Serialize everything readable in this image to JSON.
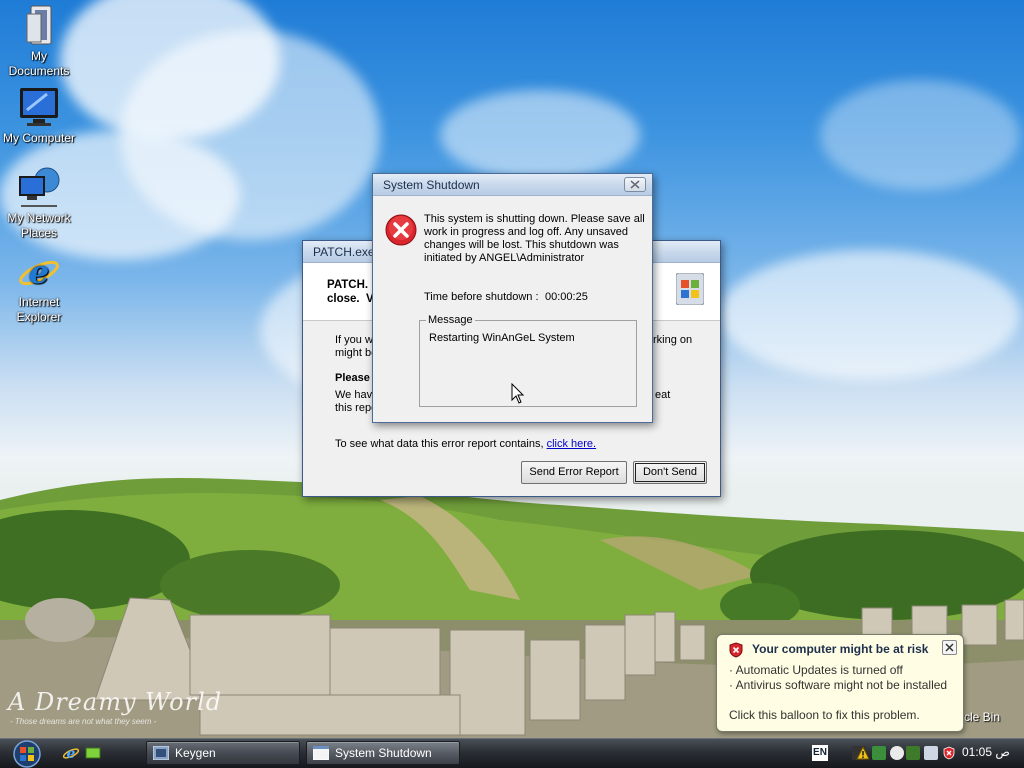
{
  "desktop": {
    "icons": [
      {
        "label": "My Documents",
        "icon": "my-documents-icon"
      },
      {
        "label": "My Computer",
        "icon": "my-computer-icon"
      },
      {
        "label": "My Network Places",
        "icon": "network-places-icon"
      },
      {
        "label": "Internet Explorer",
        "icon": "internet-explorer-icon"
      }
    ],
    "recycle_bin_label": "ycle Bin",
    "wallpaper_title": "A Dreamy World",
    "wallpaper_subtitle": "- Those dreams are not what they seem -"
  },
  "patch_window": {
    "title": "PATCH.exe",
    "header_line1": "PATCH.",
    "header_line2": "close.",
    "header_tail": "V",
    "body_line1": "If you w",
    "body_line1_end": "rking on",
    "body_line2": "might be",
    "please_label": "Please",
    "we_have": "We hav",
    "we_have_end": "eat",
    "this_report": "this repo",
    "data_text": "To see what data this error report contains, ",
    "data_link": "click here.",
    "send_button": "Send Error Report",
    "dont_send_button": "Don't Send"
  },
  "shutdown_dialog": {
    "title": "System Shutdown",
    "message": "This system is shutting down. Please save all work in progress and log off. Any unsaved changes will be lost. This shutdown was initiated by ANGEL\\Administrator",
    "message_lines": [
      "This system is shutting down. Please save all",
      "work in progress and log off. Any unsaved",
      "changes will be lost. This shutdown was",
      "initiated by ANGEL\\Administrator"
    ],
    "time_label": "Time before shutdown :",
    "time_value": "00:00:25",
    "message_group_label": "Message",
    "message_value": "Restarting WinAnGeL System"
  },
  "balloon": {
    "title": "Your computer might be at risk",
    "line1": "Automatic Updates is turned off",
    "line2": "Antivirus software might not be installed",
    "action": "Click this balloon to fix this problem."
  },
  "taskbar": {
    "tasks": [
      {
        "label": "Keygen",
        "active": false
      },
      {
        "label": "System Shutdown",
        "active": true
      }
    ],
    "language": "EN",
    "clock": "01:05 ص"
  },
  "colors": {
    "error_red": "#d9262c",
    "link": "#0000cc",
    "balloon_bg": "#fffde3"
  }
}
